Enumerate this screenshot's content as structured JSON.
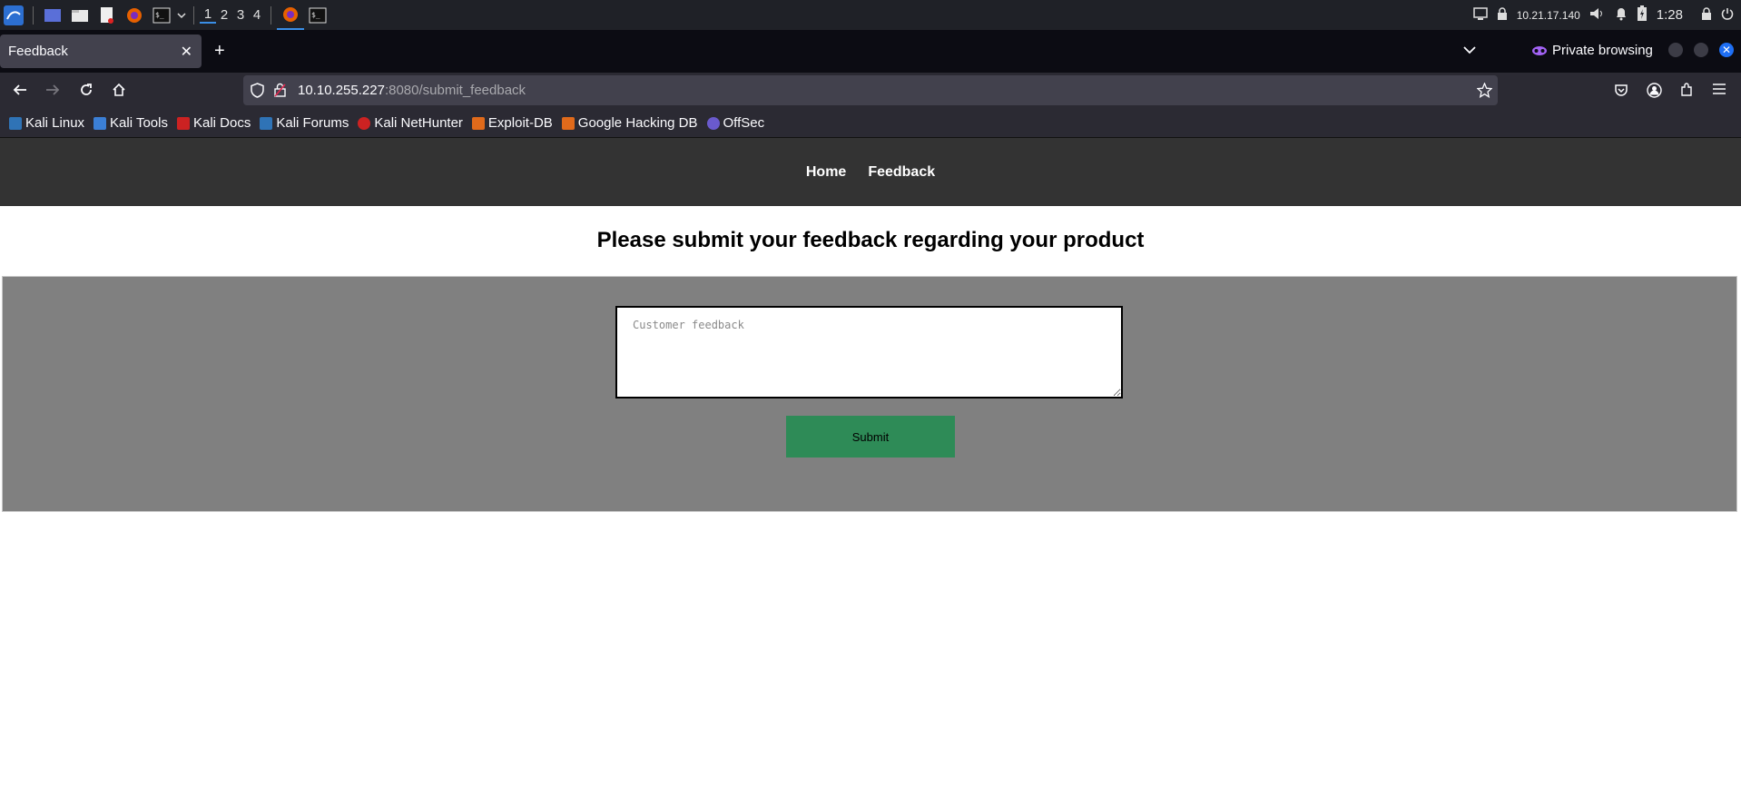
{
  "taskbar": {
    "workspaces": [
      "1",
      "2",
      "3",
      "4"
    ],
    "ip_address": "10.21.17.140",
    "clock": "1:28"
  },
  "browser": {
    "tab_title": "Feedback",
    "private_label": "Private browsing",
    "url_host": "10.10.255.227",
    "url_rest": ":8080/submit_feedback",
    "bookmarks": [
      {
        "label": "Kali Linux",
        "color": "#2f73b6"
      },
      {
        "label": "Kali Tools",
        "color": "#3b7fd6"
      },
      {
        "label": "Kali Docs",
        "color": "#cc2222"
      },
      {
        "label": "Kali Forums",
        "color": "#2f73b6"
      },
      {
        "label": "Kali NetHunter",
        "color": "#cc2222"
      },
      {
        "label": "Exploit-DB",
        "color": "#e06a1b"
      },
      {
        "label": "Google Hacking DB",
        "color": "#e06a1b"
      },
      {
        "label": "OffSec",
        "color": "#6a5acd"
      }
    ]
  },
  "site": {
    "nav": [
      "Home",
      "Feedback"
    ],
    "heading": "Please submit your feedback regarding your product",
    "feedback_placeholder": "Customer feedback",
    "submit_label": "Submit",
    "colors": {
      "nav_bg": "#333333",
      "panel_bg": "#808080",
      "submit_bg": "#2e8b57"
    }
  }
}
